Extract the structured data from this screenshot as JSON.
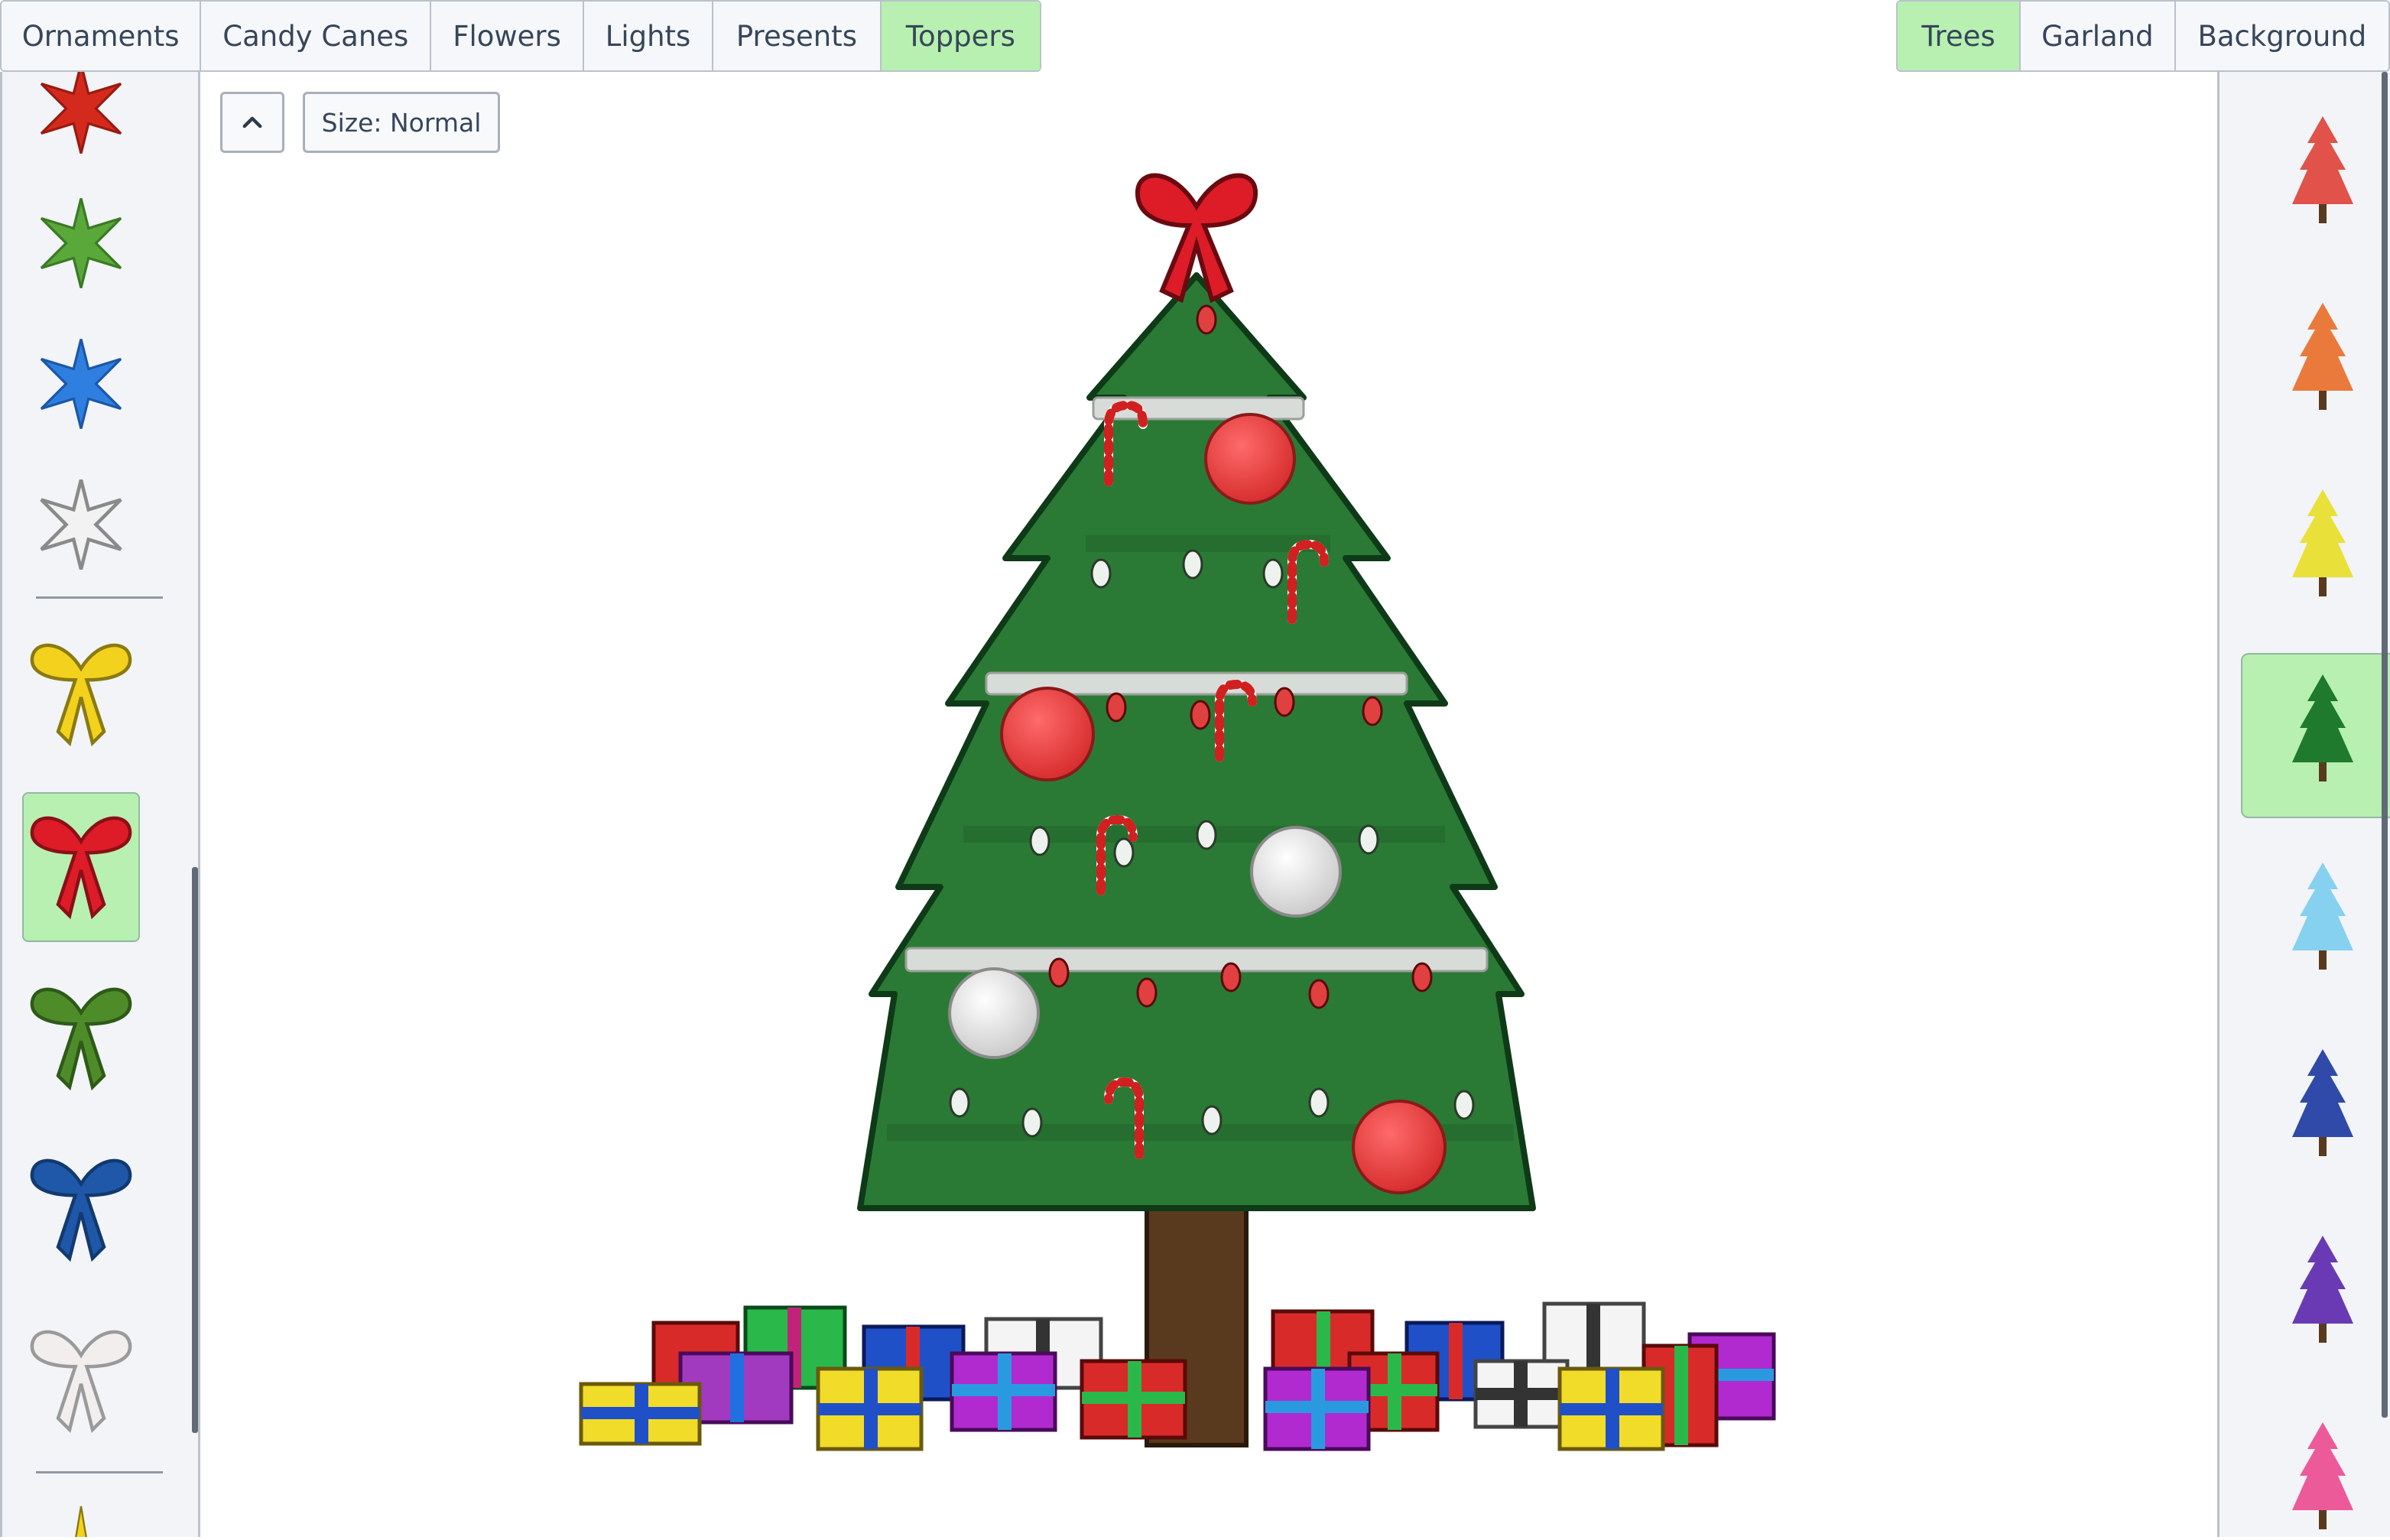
{
  "tabs_left": [
    {
      "label": "Ornaments",
      "active": false
    },
    {
      "label": "Candy Canes",
      "active": false
    },
    {
      "label": "Flowers",
      "active": false
    },
    {
      "label": "Lights",
      "active": false
    },
    {
      "label": "Presents",
      "active": false
    },
    {
      "label": "Toppers",
      "active": true
    }
  ],
  "tabs_right": [
    {
      "label": "Trees",
      "active": true
    },
    {
      "label": "Garland",
      "active": false
    },
    {
      "label": "Background",
      "active": false
    }
  ],
  "toolbar": {
    "collapse_icon": "chevron-up-icon",
    "size_label": "Size: Normal"
  },
  "toppers": {
    "stars": [
      "red",
      "green",
      "blue",
      "white"
    ],
    "bows": [
      "yellow",
      "red",
      "green",
      "blue",
      "white"
    ],
    "selected": "red-bow"
  },
  "trees": {
    "colors": [
      "#e0524a",
      "#ea7a3c",
      "#e9e03a",
      "#1f7a2e",
      "#86d0f0",
      "#2f4aa8",
      "#6a3ab4",
      "#ec5a9a"
    ],
    "selected_index": 3
  },
  "colors": {
    "accent": "#b7f0b0",
    "tree": "#2a7a35",
    "trunk": "#5a3a1e"
  }
}
